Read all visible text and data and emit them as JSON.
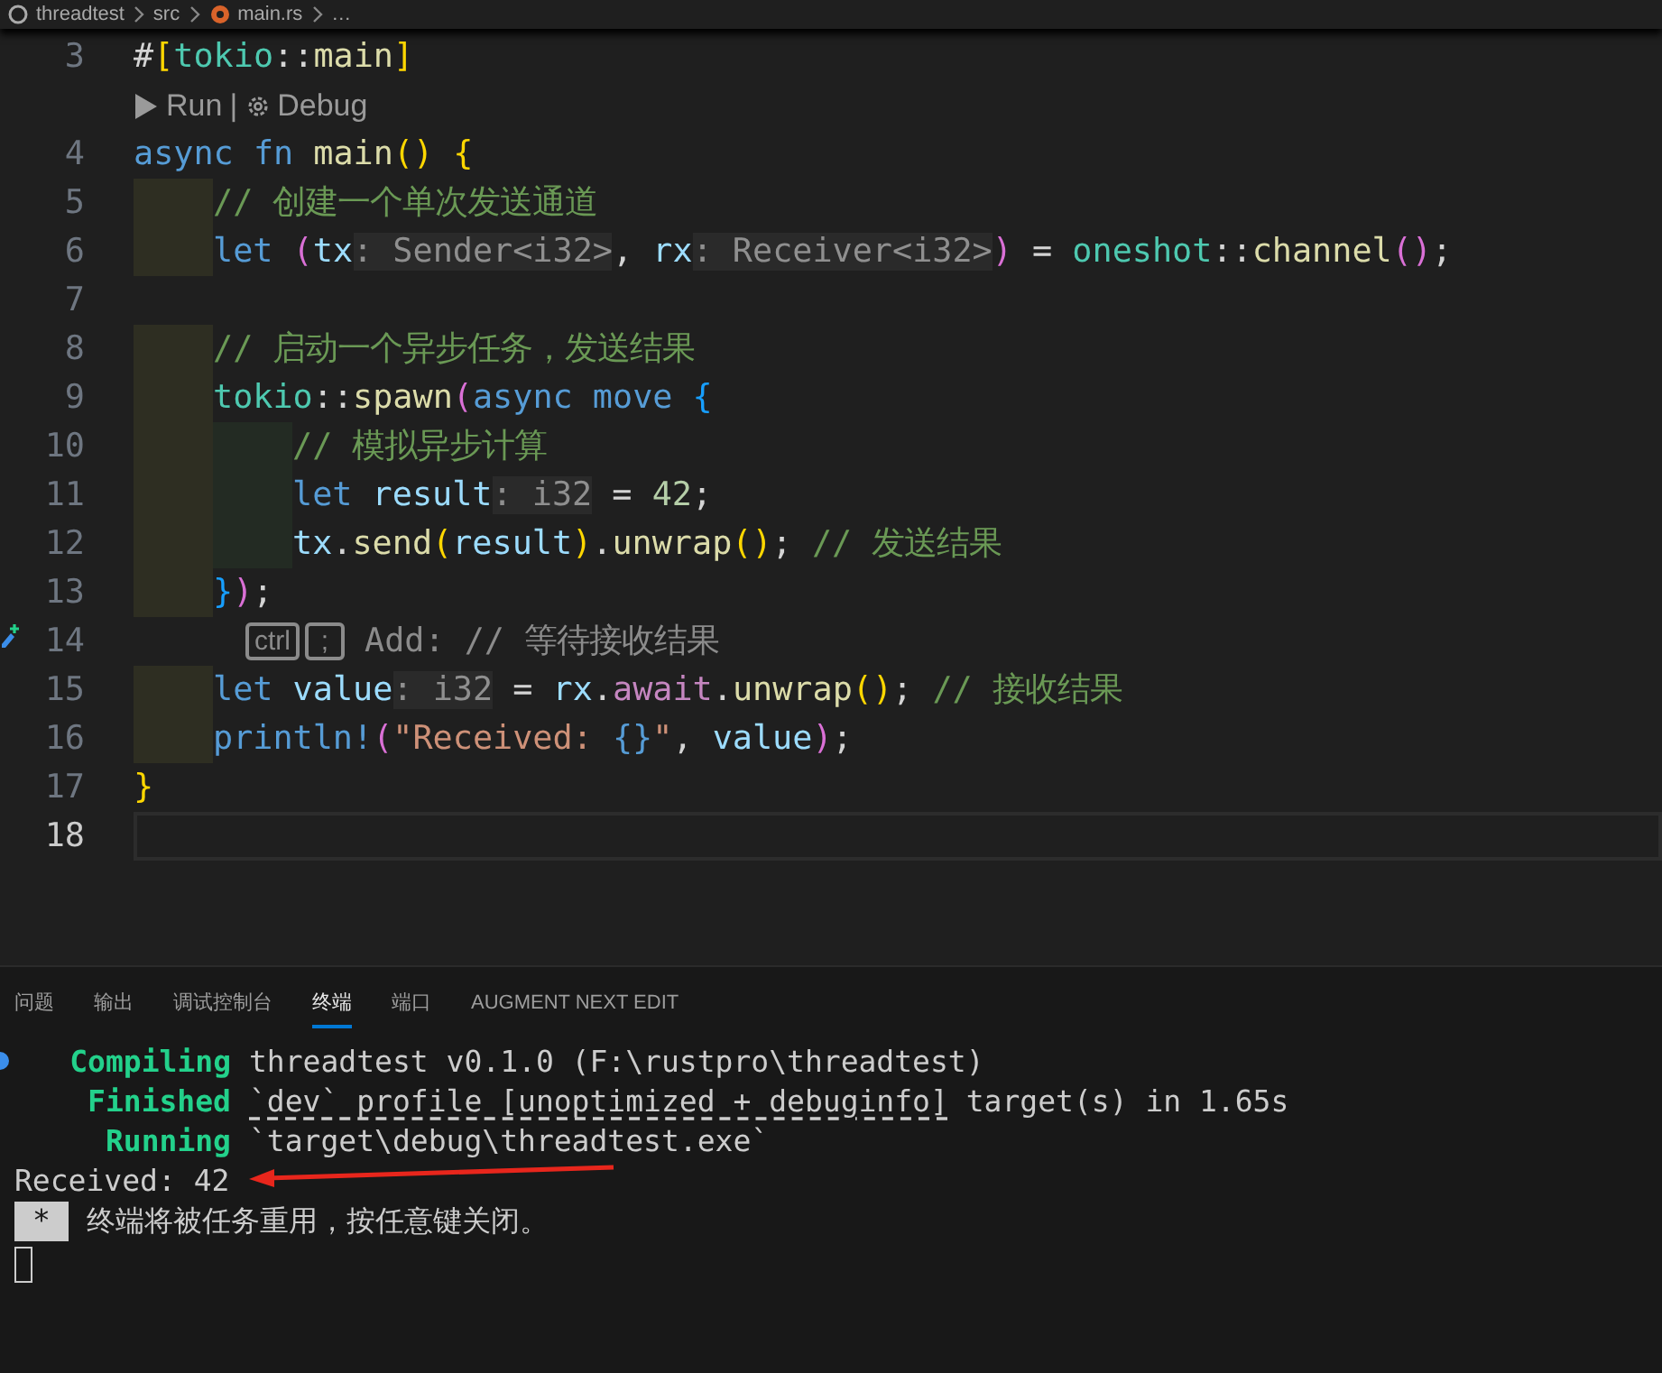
{
  "breadcrumb": [
    "threadtest",
    "src",
    "main.rs",
    "…"
  ],
  "editor": {
    "lines": [
      {
        "kind": "code",
        "number": "3",
        "current": false,
        "tokens": [
          {
            "text": "#",
            "kind": "punct"
          },
          {
            "text": "[",
            "kind": "bracket1"
          },
          {
            "text": "tokio",
            "kind": "module"
          },
          {
            "text": "::",
            "kind": "punct"
          },
          {
            "text": "main",
            "kind": "function"
          },
          {
            "text": "]",
            "kind": "bracket1"
          }
        ]
      },
      {
        "kind": "codelens",
        "actions": [
          "Run",
          "Debug"
        ],
        "separator": "|"
      },
      {
        "kind": "code",
        "number": "4",
        "current": false,
        "tokens": [
          {
            "text": "async ",
            "kind": "keyword"
          },
          {
            "text": "fn ",
            "kind": "keyword"
          },
          {
            "text": "main",
            "kind": "function"
          },
          {
            "text": "() {",
            "kind": "bracket1"
          }
        ]
      },
      {
        "kind": "code",
        "number": "5",
        "current": false,
        "guides": [
          {
            "color": "#2e2e22"
          }
        ],
        "tokens": [
          {
            "text": "// 创建一个单次发送通道",
            "kind": "comment"
          }
        ]
      },
      {
        "kind": "code",
        "number": "6",
        "current": false,
        "guides": [
          {
            "color": "#2e2e22"
          }
        ],
        "tokens": [
          {
            "text": "let ",
            "kind": "keyword"
          },
          {
            "text": "(",
            "kind": "bracket2"
          },
          {
            "text": "tx",
            "kind": "variable"
          },
          {
            "text": ": Sender<i32>",
            "kind": "inlay"
          },
          {
            "text": ", ",
            "kind": "punct"
          },
          {
            "text": "rx",
            "kind": "variable"
          },
          {
            "text": ": Receiver<i32>",
            "kind": "inlay"
          },
          {
            "text": ")",
            "kind": "bracket2"
          },
          {
            "text": " = ",
            "kind": "punct"
          },
          {
            "text": "oneshot",
            "kind": "module"
          },
          {
            "text": "::",
            "kind": "punct"
          },
          {
            "text": "channel",
            "kind": "function"
          },
          {
            "text": "()",
            "kind": "bracket2"
          },
          {
            "text": ";",
            "kind": "punct"
          }
        ]
      },
      {
        "kind": "code",
        "number": "7",
        "current": false
      },
      {
        "kind": "code",
        "number": "8",
        "current": false,
        "guides": [
          {
            "color": "#2e2e22"
          }
        ],
        "tokens": [
          {
            "text": "// 启动一个异步任务，发送结果",
            "kind": "comment"
          }
        ]
      },
      {
        "kind": "code",
        "number": "9",
        "current": false,
        "guides": [
          {
            "color": "#2e2e22"
          }
        ],
        "tokens": [
          {
            "text": "tokio",
            "kind": "module"
          },
          {
            "text": "::",
            "kind": "punct"
          },
          {
            "text": "spawn",
            "kind": "function"
          },
          {
            "text": "(",
            "kind": "bracket2"
          },
          {
            "text": "async ",
            "kind": "keyword"
          },
          {
            "text": "move ",
            "kind": "keyword"
          },
          {
            "text": "{",
            "kind": "bracket3"
          }
        ]
      },
      {
        "kind": "code",
        "number": "10",
        "current": false,
        "guides": [
          {
            "color": "#2e2e22"
          },
          {
            "color": "#232b23"
          }
        ],
        "tokens": [
          {
            "text": "// 模拟异步计算",
            "kind": "comment"
          }
        ]
      },
      {
        "kind": "code",
        "number": "11",
        "current": false,
        "guides": [
          {
            "color": "#2e2e22"
          },
          {
            "color": "#232b23"
          }
        ],
        "tokens": [
          {
            "text": "let ",
            "kind": "keyword"
          },
          {
            "text": "result",
            "kind": "variable"
          },
          {
            "text": ": i32",
            "kind": "inlay"
          },
          {
            "text": " = ",
            "kind": "punct"
          },
          {
            "text": "42",
            "kind": "number"
          },
          {
            "text": ";",
            "kind": "punct"
          }
        ]
      },
      {
        "kind": "code",
        "number": "12",
        "current": false,
        "guides": [
          {
            "color": "#2e2e22"
          },
          {
            "color": "#232b23"
          }
        ],
        "tokens": [
          {
            "text": "tx",
            "kind": "variable"
          },
          {
            "text": ".",
            "kind": "punct"
          },
          {
            "text": "send",
            "kind": "function"
          },
          {
            "text": "(",
            "kind": "bracket1"
          },
          {
            "text": "result",
            "kind": "variable"
          },
          {
            "text": ")",
            "kind": "bracket1"
          },
          {
            "text": ".",
            "kind": "punct"
          },
          {
            "text": "unwrap",
            "kind": "function"
          },
          {
            "text": "()",
            "kind": "bracket1"
          },
          {
            "text": "; ",
            "kind": "punct"
          },
          {
            "text": "// 发送结果",
            "kind": "comment"
          }
        ]
      },
      {
        "kind": "code",
        "number": "13",
        "current": false,
        "guides": [
          {
            "color": "#2e2e22"
          }
        ],
        "tokens": [
          {
            "text": "}",
            "kind": "bracket3"
          },
          {
            "text": ")",
            "kind": "bracket2"
          },
          {
            "text": ";",
            "kind": "punct"
          }
        ]
      },
      {
        "kind": "suggestion",
        "number": "14",
        "keys": [
          "ctrl",
          ";"
        ],
        "text": "Add: // 等待接收结果"
      },
      {
        "kind": "code",
        "number": "15",
        "current": false,
        "guides": [
          {
            "color": "#2e2e22"
          }
        ],
        "tokens": [
          {
            "text": "let ",
            "kind": "keyword"
          },
          {
            "text": "value",
            "kind": "variable"
          },
          {
            "text": ": i32",
            "kind": "inlay"
          },
          {
            "text": " = ",
            "kind": "punct"
          },
          {
            "text": "rx",
            "kind": "variable"
          },
          {
            "text": ".",
            "kind": "punct"
          },
          {
            "text": "await",
            "kind": "control"
          },
          {
            "text": ".",
            "kind": "punct"
          },
          {
            "text": "unwrap",
            "kind": "function"
          },
          {
            "text": "()",
            "kind": "bracket1"
          },
          {
            "text": "; ",
            "kind": "punct"
          },
          {
            "text": "// 接收结果",
            "kind": "comment"
          }
        ]
      },
      {
        "kind": "code",
        "number": "16",
        "current": false,
        "guides": [
          {
            "color": "#2e2e22"
          }
        ],
        "tokens": [
          {
            "text": "println!",
            "kind": "macro"
          },
          {
            "text": "(",
            "kind": "bracket2"
          },
          {
            "text": "\"Received: ",
            "kind": "string"
          },
          {
            "text": "{}",
            "kind": "keyword"
          },
          {
            "text": "\"",
            "kind": "string"
          },
          {
            "text": ", ",
            "kind": "punct"
          },
          {
            "text": "value",
            "kind": "variable"
          },
          {
            "text": ")",
            "kind": "bracket2"
          },
          {
            "text": ";",
            "kind": "punct"
          }
        ]
      },
      {
        "kind": "code",
        "number": "17",
        "current": false,
        "tokens": [
          {
            "text": "}",
            "kind": "bracket1"
          }
        ]
      },
      {
        "kind": "code",
        "number": "18",
        "current": true
      }
    ]
  },
  "panel": {
    "tabs": [
      {
        "label": "问题",
        "selected": false
      },
      {
        "label": "输出",
        "selected": false
      },
      {
        "label": "调试控制台",
        "selected": false
      },
      {
        "label": "终端",
        "selected": true
      },
      {
        "label": "端口",
        "selected": false
      },
      {
        "label": "AUGMENT NEXT EDIT",
        "selected": false
      }
    ]
  },
  "terminal": {
    "lines": [
      {
        "kind": "cargo",
        "status": "Compiling",
        "text": "threadtest v0.1.0 (F:\\rustpro\\threadtest)"
      },
      {
        "kind": "cargo",
        "status": "Finished",
        "link": "`dev` profile [unoptimized + debuginfo]",
        "text": " target(s) in 1.65s"
      },
      {
        "kind": "cargo",
        "status": "Running",
        "text": "`target\\debug\\threadtest.exe`"
      },
      {
        "kind": "plain",
        "text": "Received: 42"
      },
      {
        "kind": "notice",
        "badge": "*",
        "text": "终端将被任务重用，按任意键关闭。"
      },
      {
        "kind": "cursor"
      }
    ]
  }
}
